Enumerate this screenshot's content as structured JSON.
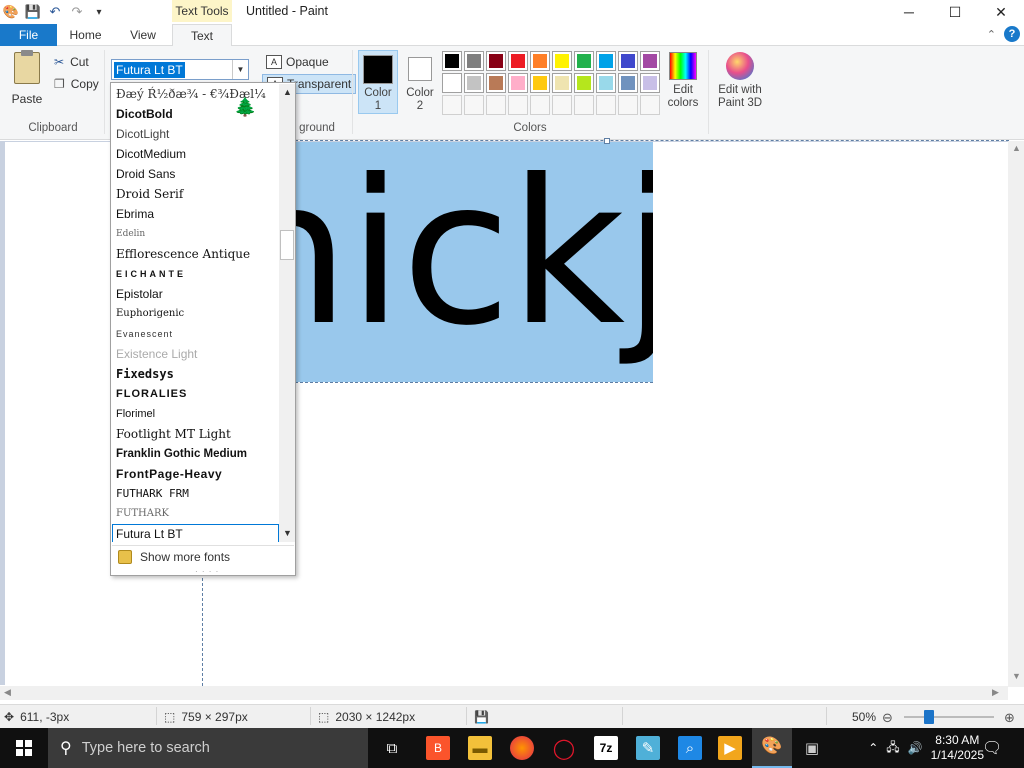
{
  "window": {
    "title": "Untitled - Paint",
    "context_tab": "Text Tools",
    "min": "─",
    "max": "☐",
    "close": "✕"
  },
  "tabs": [
    {
      "label": "File"
    },
    {
      "label": "Home"
    },
    {
      "label": "View"
    },
    {
      "label": "Text"
    }
  ],
  "ribbon": {
    "clipboard": {
      "paste": "Paste",
      "cut": "Cut",
      "copy": "Copy",
      "group": "Clipboard"
    },
    "font": {
      "current": "Futura Lt BT"
    },
    "background": {
      "opaque": "Opaque",
      "transparent": "Transparent",
      "group_tail": "ground"
    },
    "colors": {
      "color1": "Color\n1",
      "color1_label_a": "Color",
      "color1_label_b": "1",
      "color2_label_a": "Color",
      "color2_label_b": "2",
      "group": "Colors",
      "color1_value": "#000000",
      "color2_value": "#ffffff",
      "palette_row1": [
        "#000000",
        "#7f7f7f",
        "#880015",
        "#ed1c24",
        "#ff7f27",
        "#fff200",
        "#22b14c",
        "#00a2e8",
        "#3f48cc",
        "#a349a4"
      ],
      "palette_row2": [
        "#ffffff",
        "#c3c3c3",
        "#b97a57",
        "#ffaec9",
        "#ffc90e",
        "#efe4b0",
        "#b5e61d",
        "#99d9ea",
        "#7092be",
        "#c8bfe7"
      ],
      "edit_colors_a": "Edit",
      "edit_colors_b": "colors",
      "paint3d_a": "Edit with",
      "paint3d_b": "Paint 3D"
    }
  },
  "font_dropdown": {
    "items": [
      {
        "label": "Ðæý Ŕ½ðæ¾ - €¾Ðæl¼",
        "style": "font-family:'DejaVu Serif',serif;color:#333"
      },
      {
        "label": "DicotBold",
        "style": "font-weight:bold"
      },
      {
        "label": "DicotLight",
        "style": "color:#444"
      },
      {
        "label": "DicotMedium",
        "style": ""
      },
      {
        "label": "Droid Sans",
        "style": ""
      },
      {
        "label": "Droid Serif",
        "style": "font-family:'DejaVu Serif',serif"
      },
      {
        "label": "Ebrima",
        "style": ""
      },
      {
        "label": "Edelin",
        "style": "font-family:'DejaVu Serif',serif;font-size:9px;color:#666"
      },
      {
        "label": "Efflorescence Antique",
        "style": "font-family:'DejaVu Serif',serif"
      },
      {
        "label": "EICHANTE",
        "style": "letter-spacing:3px;font-size:9px;font-weight:bold"
      },
      {
        "label": "Epistolar",
        "style": ""
      },
      {
        "label": "Euphorigenic",
        "style": "font-family:'DejaVu Serif',serif;font-size:10px"
      },
      {
        "label": "Evanescent",
        "style": "font-size:9px;letter-spacing:1px;color:#333"
      },
      {
        "label": "Existence Light",
        "style": "color:#aaa"
      },
      {
        "label": "Fixedsys",
        "style": "font-family:'DejaVu Sans Mono',monospace;font-weight:bold"
      },
      {
        "label": "FLORALIES",
        "style": "font-weight:bold;font-size:11px;letter-spacing:1px"
      },
      {
        "label": "Florimel",
        "style": "font-size:11px"
      },
      {
        "label": "Footlight MT Light",
        "style": "font-family:'DejaVu Serif',serif"
      },
      {
        "label": "Franklin Gothic Medium",
        "style": "font-weight:bold;font-size:11.5px"
      },
      {
        "label": "FrontPage-Heavy",
        "style": "font-weight:bold;letter-spacing:0.5px"
      },
      {
        "label": "FUTHARK FRM",
        "style": "font-family:'DejaVu Sans Mono',monospace;font-size:11px"
      },
      {
        "label": "FUTHARK",
        "style": "font-family:'DejaVu Serif',serif;font-size:10px;color:#666"
      },
      {
        "label": "Futura Lt BT",
        "style": "",
        "selected": true
      }
    ],
    "show_more": "Show more fonts"
  },
  "canvas": {
    "text": "nickjr"
  },
  "status": {
    "cursor_pos": "611, -3px",
    "selection_size": "759 × 297px",
    "image_size": "2030 × 1242px",
    "zoom": "50%"
  },
  "taskbar": {
    "search_placeholder": "Type here to search",
    "time": "8:30 AM",
    "date": "1/14/2025"
  }
}
